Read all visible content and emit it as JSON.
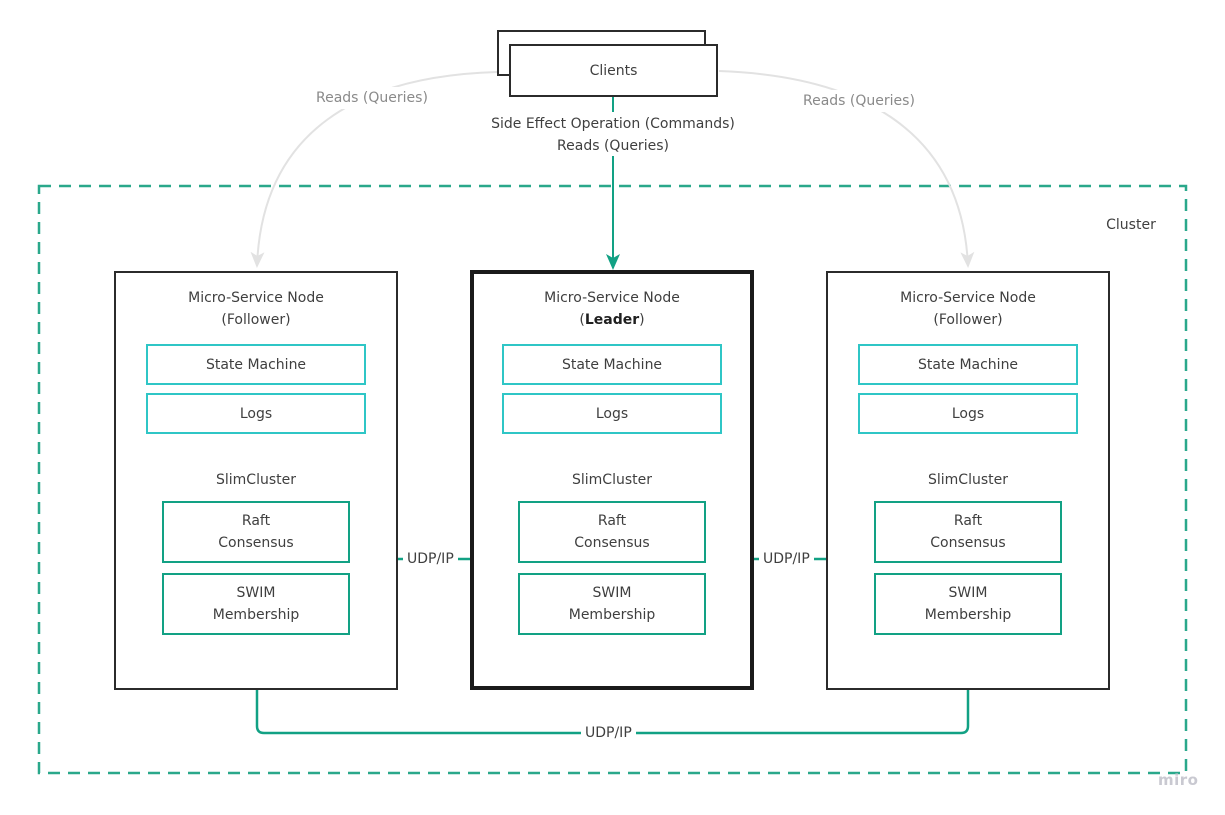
{
  "diagram": {
    "clients": {
      "label": "Clients"
    },
    "edges": {
      "client_to_leader": {
        "line1": "Side Effect Operation (Commands)",
        "line2": "Reads (Queries)"
      },
      "client_to_left_follower": {
        "label": "Reads (Queries)"
      },
      "client_to_right_follower": {
        "label": "Reads (Queries)"
      },
      "left_to_leader": {
        "label": "UDP/IP"
      },
      "leader_to_right": {
        "label": "UDP/IP"
      },
      "left_to_right": {
        "label": "UDP/IP"
      }
    },
    "cluster": {
      "label": "Cluster"
    },
    "nodes": [
      {
        "title": "Micro-Service Node",
        "role_prefix": "(",
        "role": "Follower",
        "role_suffix": ")",
        "state_machine": "State Machine",
        "logs": "Logs",
        "slimcluster": "SlimCluster",
        "raft": [
          "Raft",
          "Consensus"
        ],
        "swim": [
          "SWIM",
          "Membership"
        ]
      },
      {
        "title": "Micro-Service Node",
        "role_prefix": "(",
        "role": "Leader",
        "role_suffix": ")",
        "state_machine": "State Machine",
        "logs": "Logs",
        "slimcluster": "SlimCluster",
        "raft": [
          "Raft",
          "Consensus"
        ],
        "swim": [
          "SWIM",
          "Membership"
        ]
      },
      {
        "title": "Micro-Service Node",
        "role_prefix": "(",
        "role": "Follower",
        "role_suffix": ")",
        "state_machine": "State Machine",
        "logs": "Logs",
        "slimcluster": "SlimCluster",
        "raft": [
          "Raft",
          "Consensus"
        ],
        "swim": [
          "SWIM",
          "Membership"
        ]
      }
    ],
    "watermark": "miro",
    "colors": {
      "accent_green": "#12a184",
      "cyan": "#2fc6c6",
      "grey_edge": "#e2e2e2",
      "node_border": "#2b2b2b"
    }
  }
}
